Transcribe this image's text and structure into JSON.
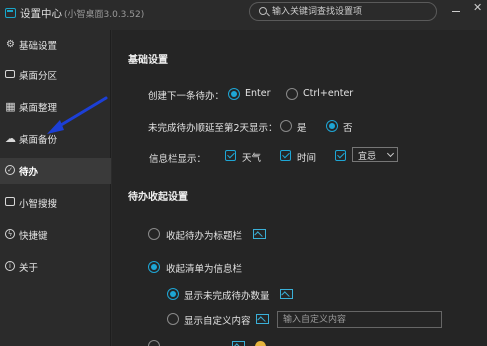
{
  "window": {
    "title": "设置中心",
    "version": "(小智桌面3.0.3.52)",
    "search_placeholder": "输入关键词查找设置项"
  },
  "sidebar": {
    "items": [
      {
        "label": "基础设置",
        "icon": "gear-icon"
      },
      {
        "label": "桌面分区",
        "icon": "monitor-icon"
      },
      {
        "label": "桌面整理",
        "icon": "grid-icon"
      },
      {
        "label": "桌面备份",
        "icon": "cloud-icon"
      },
      {
        "label": "待办",
        "icon": "check-circle-icon",
        "active": true
      },
      {
        "label": "小智搜搜",
        "icon": "search-box-icon"
      },
      {
        "label": "快捷键",
        "icon": "lightning-icon"
      },
      {
        "label": "关于",
        "icon": "info-icon"
      }
    ]
  },
  "basic": {
    "title": "基础设置",
    "create_next_label": "创建下一条待办：",
    "create_next_options": [
      "Enter",
      "Ctrl+enter"
    ],
    "create_next_selected": "Enter",
    "carry_over_label": "未完成待办顺延至第2天显示：",
    "carry_over_options": [
      "是",
      "否"
    ],
    "carry_over_selected": "否",
    "infobar_label": "信息栏显示：",
    "infobar_options": [
      {
        "label": "天气",
        "checked": true
      },
      {
        "label": "时间",
        "checked": true
      },
      {
        "label": "宜忌",
        "checked": true,
        "type": "select"
      }
    ]
  },
  "collapse": {
    "title": "待办收起设置",
    "option1": "收起待办为标题栏",
    "option2": "收起清单为信息栏",
    "sub1": "显示未完成待办数量",
    "sub2": "显示自定义内容",
    "custom_placeholder": "输入自定义内容"
  },
  "colors": {
    "accent": "#1ea6d5",
    "annotation": "#1c3fd6"
  }
}
